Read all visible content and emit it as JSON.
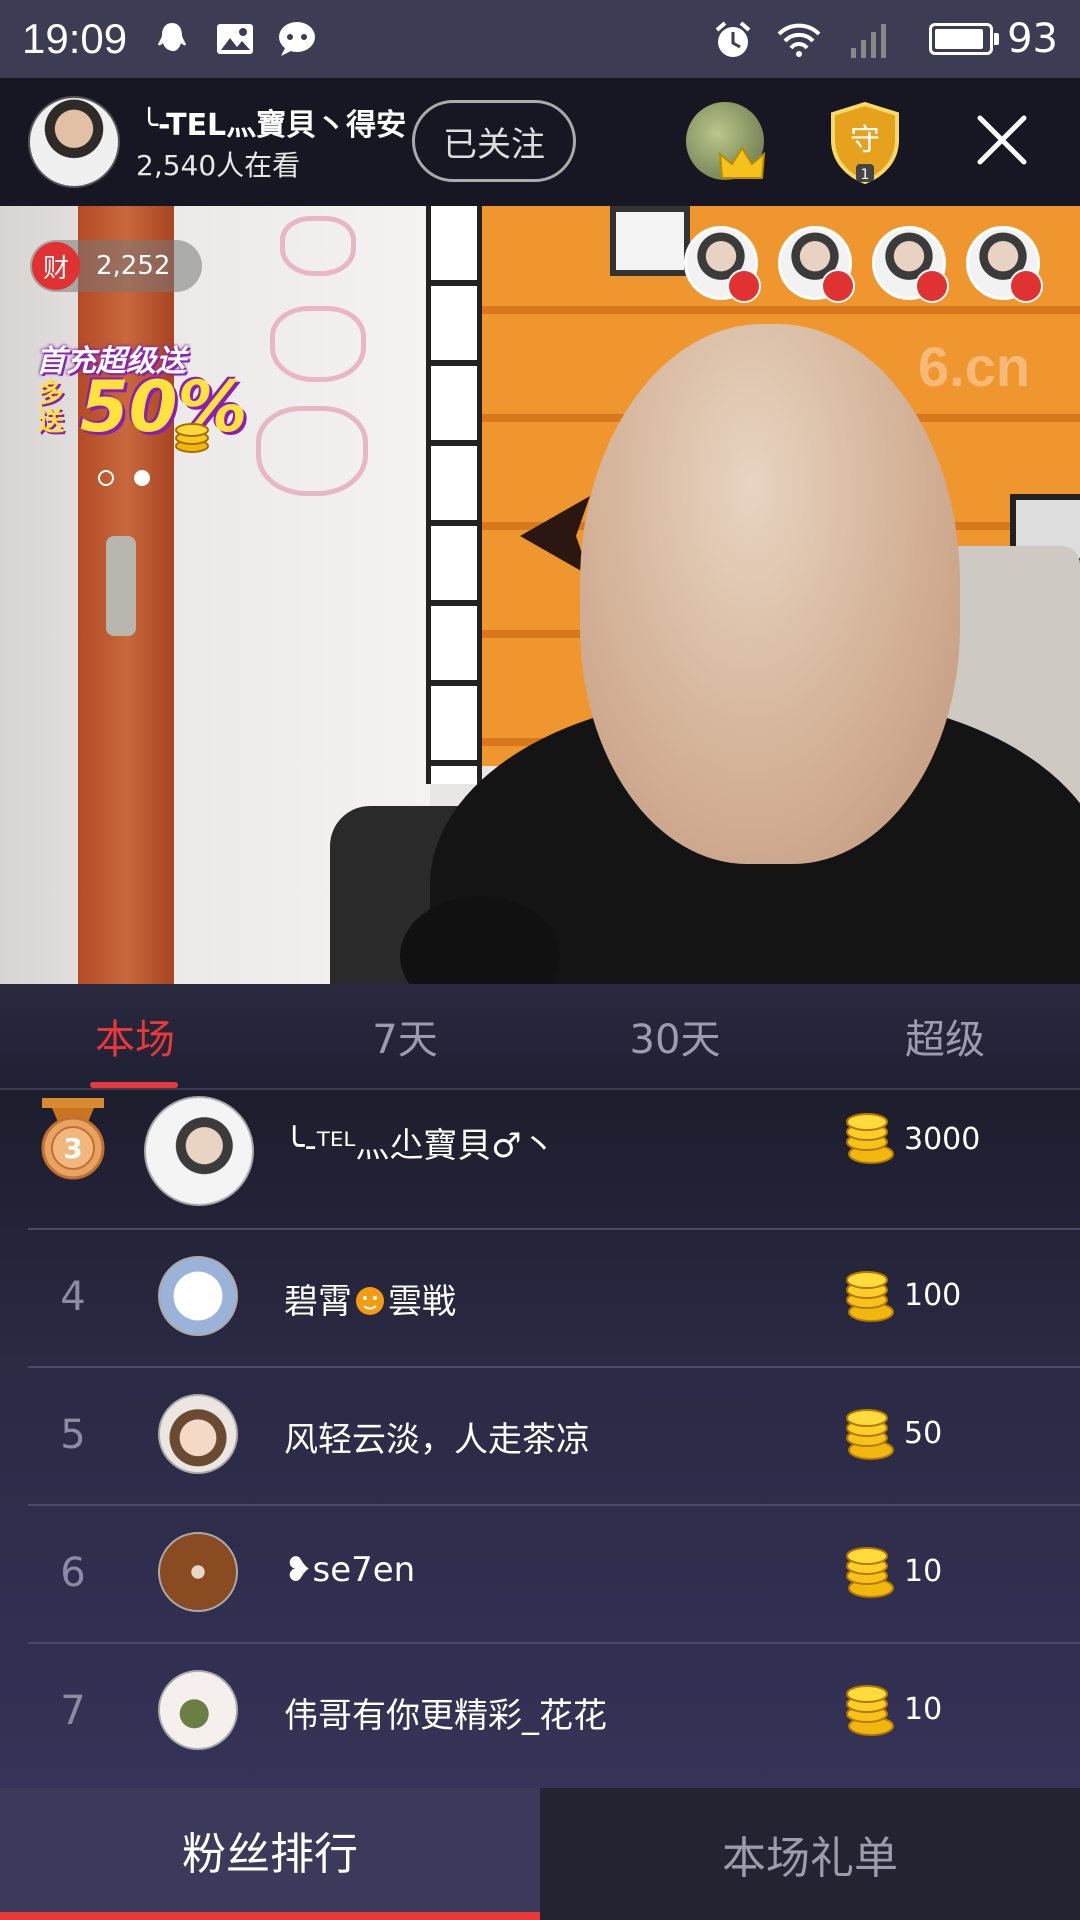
{
  "status_bar": {
    "time": "19:09",
    "battery": "93",
    "battery_level": 0.93,
    "icons": [
      "qq-icon",
      "image-icon",
      "chat-icon",
      "alarm-icon",
      "wifi-icon",
      "signal-icon"
    ]
  },
  "header": {
    "host_name": "╰-TEL灬寶貝丶得安",
    "viewers": "2,540人在看",
    "follow_label": "已关注",
    "guard_count": "1"
  },
  "video": {
    "wealth_badge": "财",
    "wealth_value": "2,252",
    "promo_line1": "首充超级送",
    "promo_line2a": "多",
    "promo_line2b": "送",
    "promo_percent": "50%",
    "watermark": "6.cn",
    "carousel_pages": 2,
    "carousel_active": 2
  },
  "tabs": [
    {
      "label": "本场",
      "active": true
    },
    {
      "label": "7天",
      "active": false
    },
    {
      "label": "30天",
      "active": false
    },
    {
      "label": "超级",
      "active": false
    }
  ],
  "ranking": [
    {
      "rank": "3",
      "name": "╰-ᵀᴱᴸ灬尐寶貝♂丶",
      "amount": "3000"
    },
    {
      "rank": "4",
      "name": "碧霄",
      "name2": "雲戦",
      "amount": "100"
    },
    {
      "rank": "5",
      "name": "风轻云淡，人走茶凉",
      "amount": "50"
    },
    {
      "rank": "6",
      "name": "❥se7en",
      "amount": "10"
    },
    {
      "rank": "7",
      "name": "伟哥有你更精彩_花花",
      "amount": "10"
    }
  ],
  "bottom_tabs": {
    "fans_label": "粉丝排行",
    "gift_label": "本场礼单"
  },
  "colors": {
    "accent": "#e8383a",
    "header_bg": "#161722",
    "status_bg": "#3c3d55"
  }
}
